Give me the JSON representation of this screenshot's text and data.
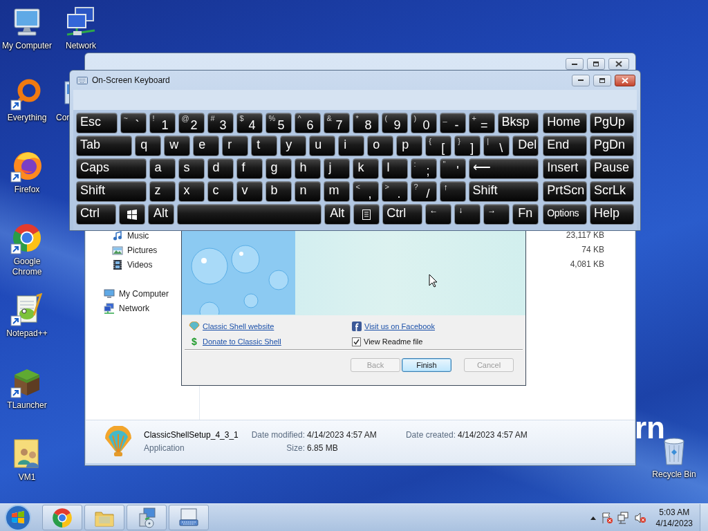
{
  "desktop_icons": [
    {
      "label": "My Computer",
      "kind": "computer",
      "shortcut": false
    },
    {
      "label": "Everything",
      "kind": "everything",
      "shortcut": true
    },
    {
      "label": "Firefox",
      "kind": "firefox",
      "shortcut": true
    },
    {
      "label": "Google Chrome",
      "kind": "chrome",
      "shortcut": true
    },
    {
      "label": "Notepad++",
      "kind": "notepad",
      "shortcut": true
    },
    {
      "label": "TLauncher",
      "kind": "tlauncher",
      "shortcut": true
    },
    {
      "label": "VM1",
      "kind": "userfolder",
      "shortcut": false
    },
    {
      "label": "Network",
      "kind": "network",
      "shortcut": false
    },
    {
      "label": "Cor",
      "kind": "controlpanel",
      "shortcut": false
    }
  ],
  "recycle_bin": {
    "label": "Recycle Bin"
  },
  "wallpaper_text": "rn",
  "explorer": {
    "nav": {
      "libraries": [
        {
          "label": "Music",
          "kind": "music"
        },
        {
          "label": "Pictures",
          "kind": "pictures"
        },
        {
          "label": "Videos",
          "kind": "videos"
        }
      ],
      "locations": [
        {
          "label": "My Computer",
          "kind": "computer"
        },
        {
          "label": "Network",
          "kind": "network"
        }
      ]
    },
    "sizes": [
      "23,117 KB",
      "74 KB",
      "4,081 KB"
    ],
    "details": {
      "name": "ClassicShellSetup_4_3_1",
      "type": "Application",
      "date_modified_label": "Date modified:",
      "date_modified": "4/14/2023 4:57 AM",
      "size_label": "Size:",
      "size": "6.85 MB",
      "date_created_label": "Date created:",
      "date_created": "4/14/2023 4:57 AM"
    }
  },
  "installer": {
    "links": [
      {
        "label": "Classic Shell website",
        "kind": "shell"
      },
      {
        "label": "Visit us on Facebook",
        "kind": "facebook"
      },
      {
        "label": "Donate to Classic Shell",
        "kind": "donate",
        "icon": "$"
      }
    ],
    "checkbox": {
      "label": "View Readme file",
      "checked": true
    },
    "buttons": [
      {
        "label": "Back",
        "disabled": true,
        "default": false
      },
      {
        "label": "Finish",
        "disabled": false,
        "default": true
      },
      {
        "label": "Cancel",
        "disabled": true,
        "default": false
      }
    ]
  },
  "keyboard": {
    "title": "On-Screen Keyboard",
    "rows": [
      {
        "keys": [
          {
            "label": "Esc",
            "kind": "wide"
          },
          {
            "label": "`",
            "shift": "~",
            "kind": "char"
          },
          {
            "label": "1",
            "shift": "!",
            "kind": "char"
          },
          {
            "label": "2",
            "shift": "@",
            "kind": "char"
          },
          {
            "label": "3",
            "shift": "#",
            "kind": "char"
          },
          {
            "label": "4",
            "shift": "$",
            "kind": "char"
          },
          {
            "label": "5",
            "shift": "%",
            "kind": "char"
          },
          {
            "label": "6",
            "shift": "^",
            "kind": "char"
          },
          {
            "label": "7",
            "shift": "&",
            "kind": "char"
          },
          {
            "label": "8",
            "shift": "*",
            "kind": "char"
          },
          {
            "label": "9",
            "shift": "(",
            "kind": "char"
          },
          {
            "label": "0",
            "shift": ")",
            "kind": "char"
          },
          {
            "label": "-",
            "shift": "_",
            "kind": "char"
          },
          {
            "label": "=",
            "shift": "+",
            "kind": "char"
          },
          {
            "label": "Bksp",
            "kind": "wide"
          }
        ]
      },
      {
        "keys": [
          {
            "label": "Tab",
            "kind": "wide"
          },
          {
            "label": "q",
            "kind": "char"
          },
          {
            "label": "w",
            "kind": "char"
          },
          {
            "label": "e",
            "kind": "char"
          },
          {
            "label": "r",
            "kind": "char"
          },
          {
            "label": "t",
            "kind": "char"
          },
          {
            "label": "y",
            "kind": "char"
          },
          {
            "label": "u",
            "kind": "char"
          },
          {
            "label": "i",
            "kind": "char"
          },
          {
            "label": "o",
            "kind": "char"
          },
          {
            "label": "p",
            "kind": "char"
          },
          {
            "label": "[",
            "shift": "{",
            "kind": "char"
          },
          {
            "label": "]",
            "shift": "}",
            "kind": "char"
          },
          {
            "label": "\\",
            "shift": "|",
            "kind": "char"
          },
          {
            "label": "Del",
            "kind": "char"
          }
        ]
      },
      {
        "keys": [
          {
            "label": "Caps",
            "kind": "wide"
          },
          {
            "label": "a",
            "kind": "char"
          },
          {
            "label": "s",
            "kind": "char"
          },
          {
            "label": "d",
            "kind": "char"
          },
          {
            "label": "f",
            "kind": "char"
          },
          {
            "label": "g",
            "kind": "char"
          },
          {
            "label": "h",
            "kind": "char"
          },
          {
            "label": "j",
            "kind": "char"
          },
          {
            "label": "k",
            "kind": "char"
          },
          {
            "label": "l",
            "kind": "char"
          },
          {
            "label": ";",
            "shift": ":",
            "kind": "char"
          },
          {
            "label": "'",
            "shift": "\"",
            "kind": "char"
          },
          {
            "label": "⟵",
            "kind": "wide"
          }
        ]
      },
      {
        "keys": [
          {
            "label": "Shift",
            "kind": "wide"
          },
          {
            "label": "z",
            "kind": "char"
          },
          {
            "label": "x",
            "kind": "char"
          },
          {
            "label": "c",
            "kind": "char"
          },
          {
            "label": "v",
            "kind": "char"
          },
          {
            "label": "b",
            "kind": "char"
          },
          {
            "label": "n",
            "kind": "char"
          },
          {
            "label": "m",
            "kind": "char"
          },
          {
            "label": ",",
            "shift": "<",
            "kind": "char"
          },
          {
            "label": ".",
            "shift": ">",
            "kind": "char"
          },
          {
            "label": "/",
            "shift": "?",
            "kind": "char"
          },
          {
            "label": "↑",
            "kind": "arrow"
          },
          {
            "label": "Shift",
            "kind": "wide"
          }
        ]
      },
      {
        "keys": [
          {
            "label": "Ctrl",
            "kind": "mod"
          },
          {
            "kind": "windows"
          },
          {
            "label": "Alt",
            "kind": "char"
          },
          {
            "kind": "space"
          },
          {
            "label": "Alt",
            "kind": "char"
          },
          {
            "kind": "menu"
          },
          {
            "label": "Ctrl",
            "kind": "mod"
          },
          {
            "label": "←",
            "kind": "arrow"
          },
          {
            "label": "↓",
            "kind": "arrow"
          },
          {
            "label": "→",
            "kind": "arrow"
          },
          {
            "label": "Fn",
            "kind": "char"
          }
        ]
      }
    ],
    "nav_rows": [
      {
        "keys": [
          {
            "label": "Home",
            "kind": "nav"
          },
          {
            "label": "PgUp",
            "kind": "nav"
          }
        ]
      },
      {
        "keys": [
          {
            "label": "End",
            "kind": "nav"
          },
          {
            "label": "PgDn",
            "kind": "nav"
          }
        ]
      },
      {
        "keys": [
          {
            "label": "Insert",
            "kind": "nav"
          },
          {
            "label": "Pause",
            "kind": "nav"
          }
        ]
      },
      {
        "keys": [
          {
            "label": "PrtScn",
            "kind": "nav"
          },
          {
            "label": "ScrLk",
            "kind": "nav"
          }
        ]
      },
      {
        "keys": [
          {
            "label": "Options",
            "kind": "small"
          },
          {
            "label": "Help",
            "kind": "nav"
          }
        ]
      }
    ]
  },
  "clock": {
    "time": "5:03 AM",
    "date": "4/14/2023"
  }
}
